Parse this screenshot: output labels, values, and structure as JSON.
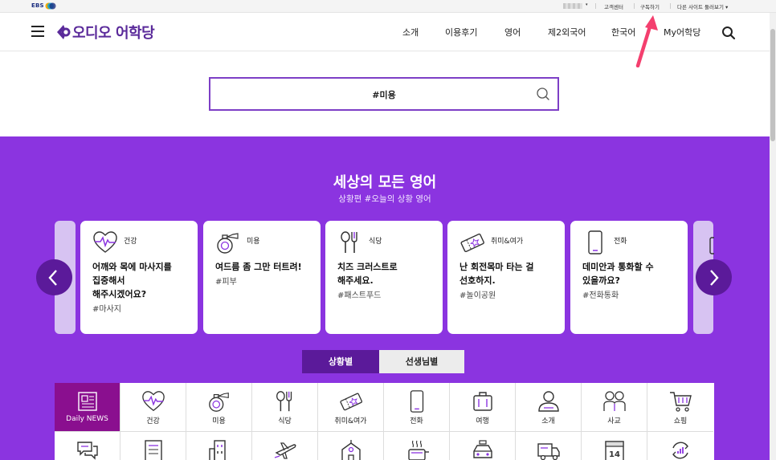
{
  "topbar": {
    "brand": "EBS",
    "links": [
      "고객센터",
      "구독하기",
      "다른 사이트 둘러보기"
    ]
  },
  "header": {
    "logo_text": "오디오 어학당",
    "nav": [
      "소개",
      "이용후기",
      "영어",
      "제2외국어",
      "한국어",
      "My어학당"
    ]
  },
  "search": {
    "query": "#미용"
  },
  "section": {
    "title": "세상의 모든 영어",
    "subtitle": "상황편 #오늘의 상황 영어"
  },
  "cards": [
    {
      "category": "건강",
      "icon": "heart-pulse-icon",
      "sentence": "어깨와 목에 마사지를\n집중해서\n해주시겠어요?",
      "tag": "#마사지"
    },
    {
      "category": "미용",
      "icon": "perfume-icon",
      "sentence": "여드름 좀 그만 터트려!",
      "tag": "#피부"
    },
    {
      "category": "식당",
      "icon": "fork-spoon-icon",
      "sentence": "치즈 크러스트로\n해주세요.",
      "tag": "#패스트푸드"
    },
    {
      "category": "취미&여가",
      "icon": "ticket-icon",
      "sentence": "난 회전목마 타는 걸\n선호하지.",
      "tag": "#놀이공원"
    },
    {
      "category": "전화",
      "icon": "phone-icon",
      "sentence": "데미안과 통화할 수\n있을까요?",
      "tag": "#전화통화"
    }
  ],
  "tabs": [
    "상황별",
    "선생님별"
  ],
  "grid": [
    {
      "label": "Daily NEWS",
      "icon": "newspaper-icon",
      "active": true
    },
    {
      "label": "건강",
      "icon": "heart-pulse-icon"
    },
    {
      "label": "미용",
      "icon": "perfume-icon"
    },
    {
      "label": "식당",
      "icon": "fork-spoon-icon"
    },
    {
      "label": "취미&여가",
      "icon": "ticket-icon"
    },
    {
      "label": "전화",
      "icon": "phone-icon"
    },
    {
      "label": "여행",
      "icon": "suitcase-icon"
    },
    {
      "label": "소개",
      "icon": "person-icon"
    },
    {
      "label": "사교",
      "icon": "people-icon"
    },
    {
      "label": "쇼핑",
      "icon": "cart-icon"
    }
  ],
  "grid_row2_icons": [
    "chat-icon",
    "document-icon",
    "building-icon",
    "airplane-icon",
    "school-icon",
    "pot-icon",
    "taxi-icon",
    "truck-icon",
    "calendar-icon",
    "chart-cycle-icon"
  ],
  "calendar_day": "14",
  "colors": {
    "accent": "#8b34e0",
    "dark_purple": "#5b1a9a",
    "news_tile": "#8a0f8f",
    "annotation": "#f43f6e"
  }
}
